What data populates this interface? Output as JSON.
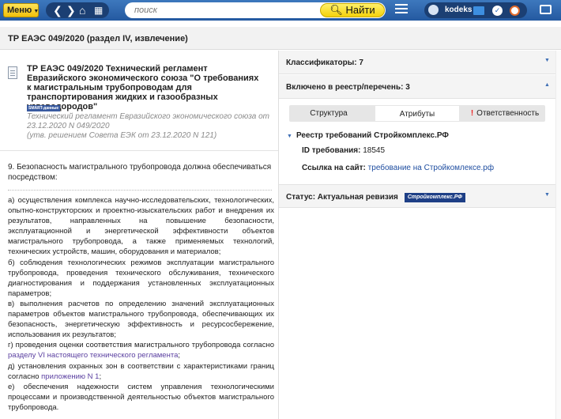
{
  "topbar": {
    "menu_label": "Меню",
    "search_placeholder": "поиск",
    "find_label": "Найти",
    "username": "kodeks"
  },
  "document": {
    "header_title": "ТР ЕАЭС 049/2020 (раздел IV, извлечение)",
    "name": "ТР ЕАЭС 049/2020 Технический регламент Евразийского экономического союза \"О требованиях к магистральным трубопроводам для транспортирования жидких и газообразных углеводородов\"",
    "smart_badge": "SMART-данные",
    "subtitle_line1": "Технический регламент Евразийского экономического союза от 23.12.2020 N 049/2020",
    "subtitle_line2": "(утв. решением Совета ЕЭК от 23.12.2020 N 121)"
  },
  "content": {
    "clause_title": "9. Безопасность магистрального трубопровода должна обеспечиваться посредством:",
    "item_a": "а) осуществления комплекса научно-исследовательских, технологических, опытно-конструкторских и проектно-изыскательских работ и внедрения их результатов, направленных на повышение безопасности, эксплуатационной и энергетической эффективности объектов магистрального трубопровода, а также применяемых технологий, технических устройств, машин, оборудования и материалов;",
    "item_b": "б) соблюдения технологических режимов эксплуатации магистрального трубопровода, проведения технического обслуживания, технического диагностирования и поддержания установленных эксплуатационных параметров;",
    "item_v": "в) выполнения расчетов по определению значений эксплуатационных параметров объектов магистрального трубопровода, обеспечивающих их безопасность, энергетическую эффективность и ресурсосбережение, использования их результатов;",
    "item_g": "г) проведения оценки соответствия магистрального трубопровода согласно",
    "item_g_link": "разделу VI настоящего технического регламента",
    "item_g_end": ";",
    "item_d": "д) установления охранных зон в соответствии с характеристиками границ согласно",
    "item_d_link": "приложению N 1",
    "item_d_end": ";",
    "item_e": "е) обеспечения надежности систем управления технологическими процессами и производственной деятельностью объектов магистрального трубопровода."
  },
  "right_panel": {
    "classifiers_label": "Классификаторы: 7",
    "included_label": "Включено в реестр/перечень: 3",
    "tabs": [
      {
        "label": "Структура"
      },
      {
        "label": "Атрибуты"
      },
      {
        "label": "Ответственность"
      }
    ],
    "registry_title": "Реестр требований Стройкомплекс.РФ",
    "req_id_label": "ID требования:",
    "req_id_value": "18545",
    "site_link_label": "Ссылка на сайт:",
    "site_link_value": "требование на Стройкомлексе.рф",
    "status_label": "Статус: Актуальная ревизия",
    "status_badge": "Стройкомплекс.РФ"
  },
  "colors": {
    "topbar": "#2f6bb3",
    "accent_yellow": "#f4d20a",
    "link": "#1d4c9f",
    "warning": "#e22222"
  }
}
